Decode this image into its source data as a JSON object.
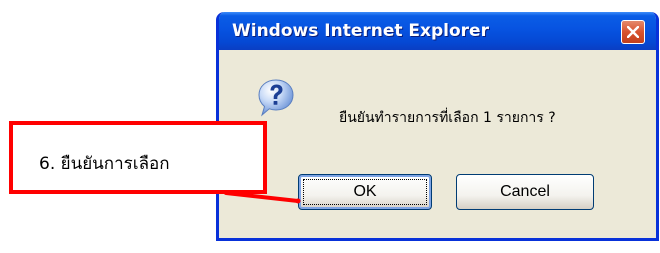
{
  "dialog": {
    "title": "Windows Internet Explorer",
    "close_icon": "close-icon",
    "message_icon": "question-icon",
    "message": "ยืนยันทำรายการที่เลือก 1 รายการ ?",
    "buttons": {
      "ok_label": "OK",
      "cancel_label": "Cancel"
    }
  },
  "annotation": {
    "text": "6. ยืนยันการเลือก",
    "color": "#ff0000"
  },
  "colors": {
    "titlebar": "#0753e1",
    "dialog_background": "#ece9d8",
    "close_button": "#d8532f"
  }
}
